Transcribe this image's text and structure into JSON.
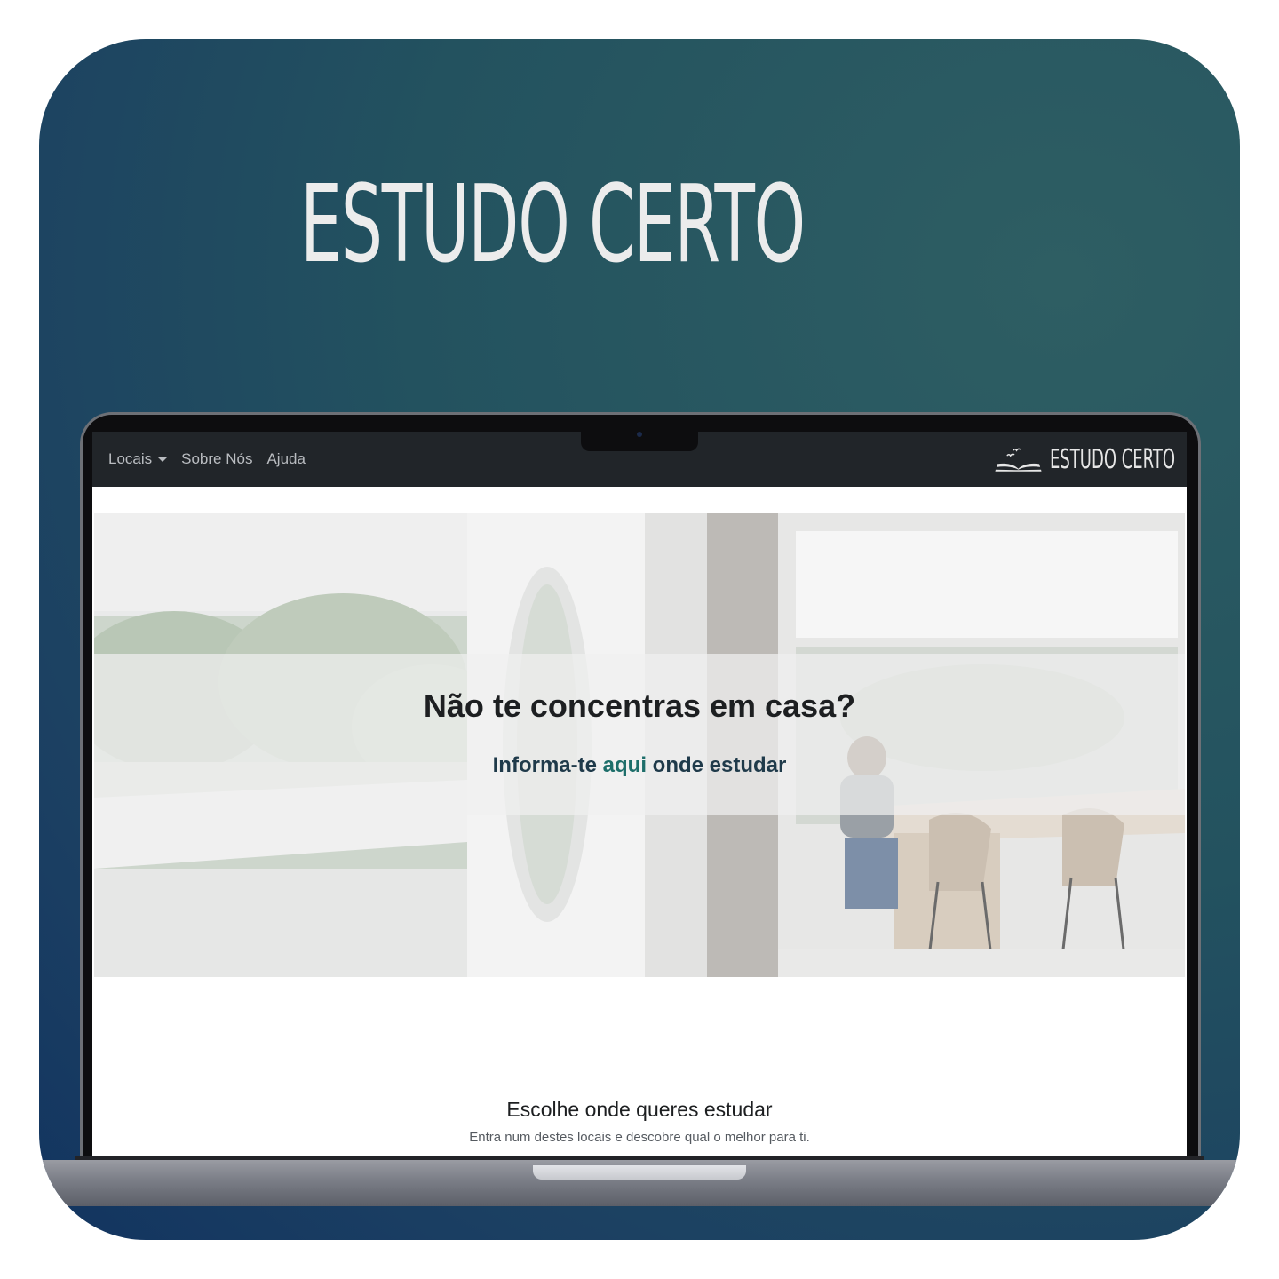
{
  "hero": {
    "brand": "ESTUDO CERTO"
  },
  "site": {
    "nav": {
      "items": [
        {
          "label": "Locais",
          "dropdown": true
        },
        {
          "label": "Sobre Nós"
        },
        {
          "label": "Ajuda"
        }
      ],
      "brand": "ESTUDO CERTO"
    },
    "banner": {
      "headline": "Não te concentras em casa?",
      "sub_prefix": "Informa-te ",
      "sub_link": "aqui",
      "sub_suffix": " onde estudar"
    },
    "section": {
      "title": "Escolhe onde queres estudar",
      "subtitle": "Entra num destes locais e descobre qual o melhor para ti."
    }
  },
  "colors": {
    "accent": "#1d6e6a",
    "navbar": "#212529",
    "background": "#23525f"
  }
}
